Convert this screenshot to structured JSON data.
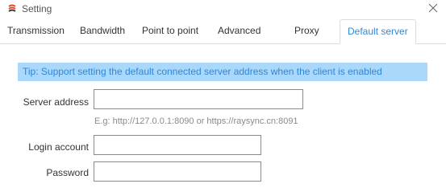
{
  "window": {
    "title": "Setting",
    "app_icon": "raysync-logo-icon",
    "close_icon": "close-icon"
  },
  "tabs": [
    {
      "label": "Transmission",
      "active": false
    },
    {
      "label": "Bandwidth",
      "active": false
    },
    {
      "label": "Point to point",
      "active": false
    },
    {
      "label": "Advanced",
      "active": false
    },
    {
      "label": "Proxy",
      "active": false
    },
    {
      "label": "Default server",
      "active": true
    }
  ],
  "default_server": {
    "tip": "Tip: Support setting the default connected server address when the client is enabled",
    "server_address_label": "Server address",
    "server_address_value": "",
    "server_address_hint": "E.g: http://127.0.0.1:8090 or https://raysync.cn:8091",
    "login_account_label": "Login account",
    "login_account_value": "",
    "password_label": "Password",
    "password_value": ""
  },
  "colors": {
    "accent": "#2f87d8",
    "tip_background": "#a9d8fb",
    "logo_red": "#e04b2a"
  }
}
